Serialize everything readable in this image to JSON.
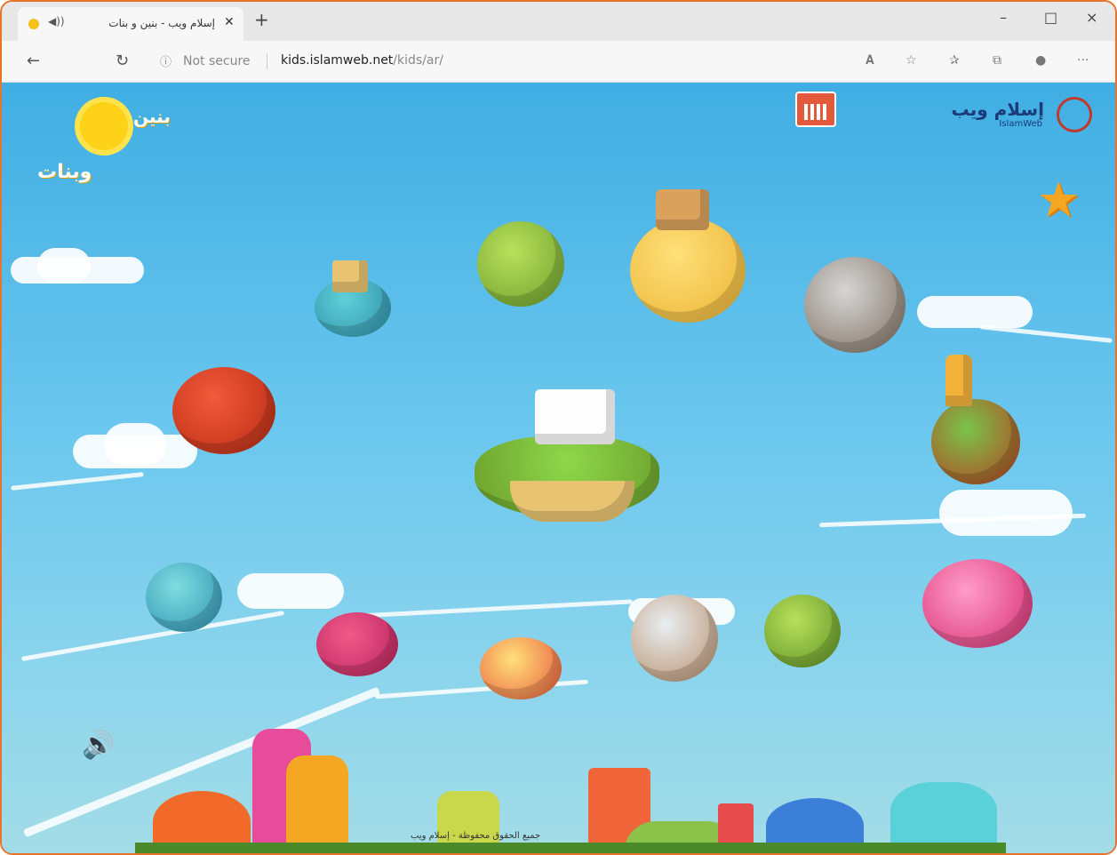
{
  "browser": {
    "tab": {
      "title": "إسلام ويب - بنين و بنات",
      "audio_icon": "speaker-icon",
      "close_icon": "close-icon"
    },
    "new_tab_icon": "plus-icon",
    "window_controls": {
      "minimize": "–",
      "maximize": "□",
      "close": "×"
    },
    "address_bar": {
      "security_label": "Not secure",
      "url_host": "kids.islamweb.net",
      "url_path": "/kids/ar/"
    },
    "nav_glyphs": {
      "back": "←",
      "reload": "↻",
      "info": "ⓘ"
    },
    "toolbar_glyphs": {
      "read_aloud": "𝐀",
      "favorite": "☆",
      "favorites": "✰",
      "collections": "⧉",
      "profile": "●",
      "more": "···"
    }
  },
  "page": {
    "site_logo": {
      "line1": "بنين",
      "line2": "وبنات"
    },
    "islamweb_logo": {
      "text": "إسلام ويب",
      "subtitle": "IslamWeb"
    },
    "footer_text": "جميع الحقوق محفوظة - إسلام ويب",
    "colors": {
      "sky_top": "#40aee3",
      "sky_bottom": "#a3dce6",
      "accent": "#e8732a"
    }
  }
}
